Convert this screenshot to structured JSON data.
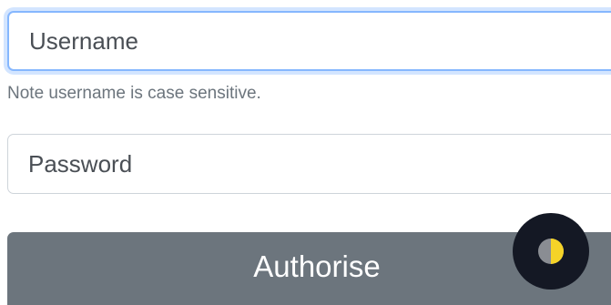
{
  "login_form": {
    "username": {
      "placeholder": "Username",
      "value": ""
    },
    "username_hint": "Note username is case sensitive.",
    "password": {
      "placeholder": "Password",
      "value": ""
    },
    "submit_label": "Authorise"
  },
  "theme_toggle": {
    "icon": "half-moon-contrast-icon",
    "background_color": "#141824",
    "icon_color": "#f5d328"
  },
  "colors": {
    "button_bg": "#6c757d",
    "focus_ring": "#86b7fe",
    "hint_text": "#6c757d"
  }
}
